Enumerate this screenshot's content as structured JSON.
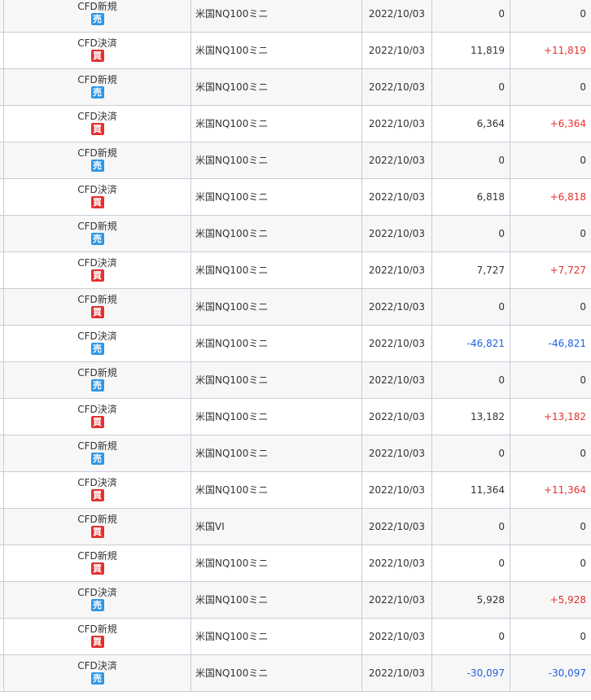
{
  "colors": {
    "sell_badge": "#2e96e6",
    "buy_badge": "#e2312f",
    "positive": "#e2312f",
    "negative": "#2060e0",
    "row_alt": "#f7f7f7",
    "grid_line": "#c7cdd8"
  },
  "rows": [
    {
      "type": "CFD新規",
      "side": "売",
      "side_class": "sell",
      "product": "米国NQ100ミニ",
      "date": "2022/10/03",
      "amount": "0",
      "profit": "0",
      "profit_class": "zero"
    },
    {
      "type": "CFD決済",
      "side": "買",
      "side_class": "buy",
      "product": "米国NQ100ミニ",
      "date": "2022/10/03",
      "amount": "11,819",
      "profit": "+11,819",
      "profit_class": "pos"
    },
    {
      "type": "CFD新規",
      "side": "売",
      "side_class": "sell",
      "product": "米国NQ100ミニ",
      "date": "2022/10/03",
      "amount": "0",
      "profit": "0",
      "profit_class": "zero"
    },
    {
      "type": "CFD決済",
      "side": "買",
      "side_class": "buy",
      "product": "米国NQ100ミニ",
      "date": "2022/10/03",
      "amount": "6,364",
      "profit": "+6,364",
      "profit_class": "pos"
    },
    {
      "type": "CFD新規",
      "side": "売",
      "side_class": "sell",
      "product": "米国NQ100ミニ",
      "date": "2022/10/03",
      "amount": "0",
      "profit": "0",
      "profit_class": "zero"
    },
    {
      "type": "CFD決済",
      "side": "買",
      "side_class": "buy",
      "product": "米国NQ100ミニ",
      "date": "2022/10/03",
      "amount": "6,818",
      "profit": "+6,818",
      "profit_class": "pos"
    },
    {
      "type": "CFD新規",
      "side": "売",
      "side_class": "sell",
      "product": "米国NQ100ミニ",
      "date": "2022/10/03",
      "amount": "0",
      "profit": "0",
      "profit_class": "zero"
    },
    {
      "type": "CFD決済",
      "side": "買",
      "side_class": "buy",
      "product": "米国NQ100ミニ",
      "date": "2022/10/03",
      "amount": "7,727",
      "profit": "+7,727",
      "profit_class": "pos"
    },
    {
      "type": "CFD新規",
      "side": "買",
      "side_class": "buy",
      "product": "米国NQ100ミニ",
      "date": "2022/10/03",
      "amount": "0",
      "profit": "0",
      "profit_class": "zero"
    },
    {
      "type": "CFD決済",
      "side": "売",
      "side_class": "sell",
      "product": "米国NQ100ミニ",
      "date": "2022/10/03",
      "amount": "-46,821",
      "amount_class": "neg",
      "profit": "-46,821",
      "profit_class": "neg"
    },
    {
      "type": "CFD新規",
      "side": "売",
      "side_class": "sell",
      "product": "米国NQ100ミニ",
      "date": "2022/10/03",
      "amount": "0",
      "profit": "0",
      "profit_class": "zero"
    },
    {
      "type": "CFD決済",
      "side": "買",
      "side_class": "buy",
      "product": "米国NQ100ミニ",
      "date": "2022/10/03",
      "amount": "13,182",
      "profit": "+13,182",
      "profit_class": "pos"
    },
    {
      "type": "CFD新規",
      "side": "売",
      "side_class": "sell",
      "product": "米国NQ100ミニ",
      "date": "2022/10/03",
      "amount": "0",
      "profit": "0",
      "profit_class": "zero"
    },
    {
      "type": "CFD決済",
      "side": "買",
      "side_class": "buy",
      "product": "米国NQ100ミニ",
      "date": "2022/10/03",
      "amount": "11,364",
      "profit": "+11,364",
      "profit_class": "pos"
    },
    {
      "type": "CFD新規",
      "side": "買",
      "side_class": "buy",
      "product": "米国VI",
      "date": "2022/10/03",
      "amount": "0",
      "profit": "0",
      "profit_class": "zero"
    },
    {
      "type": "CFD新規",
      "side": "買",
      "side_class": "buy",
      "product": "米国NQ100ミニ",
      "date": "2022/10/03",
      "amount": "0",
      "profit": "0",
      "profit_class": "zero"
    },
    {
      "type": "CFD決済",
      "side": "売",
      "side_class": "sell",
      "product": "米国NQ100ミニ",
      "date": "2022/10/03",
      "amount": "5,928",
      "profit": "+5,928",
      "profit_class": "pos"
    },
    {
      "type": "CFD新規",
      "side": "買",
      "side_class": "buy",
      "product": "米国NQ100ミニ",
      "date": "2022/10/03",
      "amount": "0",
      "profit": "0",
      "profit_class": "zero"
    },
    {
      "type": "CFD決済",
      "side": "売",
      "side_class": "sell",
      "product": "米国NQ100ミニ",
      "date": "2022/10/03",
      "amount": "-30,097",
      "amount_class": "neg",
      "profit": "-30,097",
      "profit_class": "neg"
    }
  ]
}
